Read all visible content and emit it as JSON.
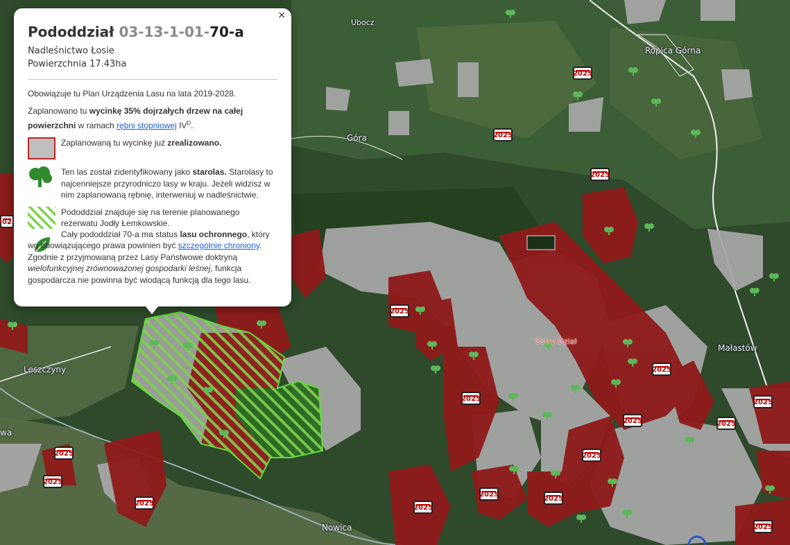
{
  "popup": {
    "close_label": "×",
    "title_prefix": "Pododdział ",
    "title_id": "03-13-1-01-",
    "title_suffix": "70-a",
    "district": "Nadleśnictwo Łosie",
    "area": "Powierzchnia 17.43ha",
    "plan_text": "Obowiązuje tu Plan Urządzenia Lasu na lata 2019-2028.",
    "cut": {
      "t1": "Zaplanowano tu ",
      "b1": "wycinkę 35% dojrzałych drzew na całej powierzchni",
      "t2": " w ramach ",
      "link": "rębni stopniowej",
      "t3": " IV",
      "sup": "D",
      "t4": "."
    },
    "realized": {
      "t1": "Zaplanowaną tu wycinkę już ",
      "b1": "zrealizowano."
    },
    "oldforest": {
      "t1": "Ten las został zidentyfikowany jako ",
      "b1": "starolas.",
      "t2": " Starolasy to najcenniejsze przyrodniczo lasy w kraju. Jeżeli widzisz w nim zaplanowaną rębnię, interweniuj w nadleśnictwie."
    },
    "reserve": {
      "t1": "Pododdział znajduje się na terenie planowanego rezerwatu Jodły Łemkowskie."
    },
    "protective": {
      "t1": "Cały pododdział 70-a ma status ",
      "b1": "lasu ochronnego",
      "t2": ", który wg obowiązującego prawa powinien być ",
      "link": "szczególnie chroniony",
      "t3": ". Zgodnie z przyjmowaną przez Lasy Państwowe doktryną ",
      "i1": "wielofunkcyjnej zrównoważonej gospodarki leśnej",
      "t4": ", funkcja gospodarcza nie powinna być wiodącą funkcją dla tego lasu."
    }
  },
  "map": {
    "places": {
      "ubocz": "Ubocz",
      "ropica": "Ropica Górna",
      "gora": "Góra",
      "ostry": "Ostry Dział",
      "malastow": "Małastów",
      "leszczyny": "Leszczyny",
      "nowica": "Nowica",
      "wa": "wa"
    },
    "badge_label": "2025",
    "colors": {
      "felled": "#8f1a1a",
      "realized": "#a6a6a6",
      "selected_outline": "#5fdc3a",
      "forest": "#2e4a2a"
    }
  }
}
